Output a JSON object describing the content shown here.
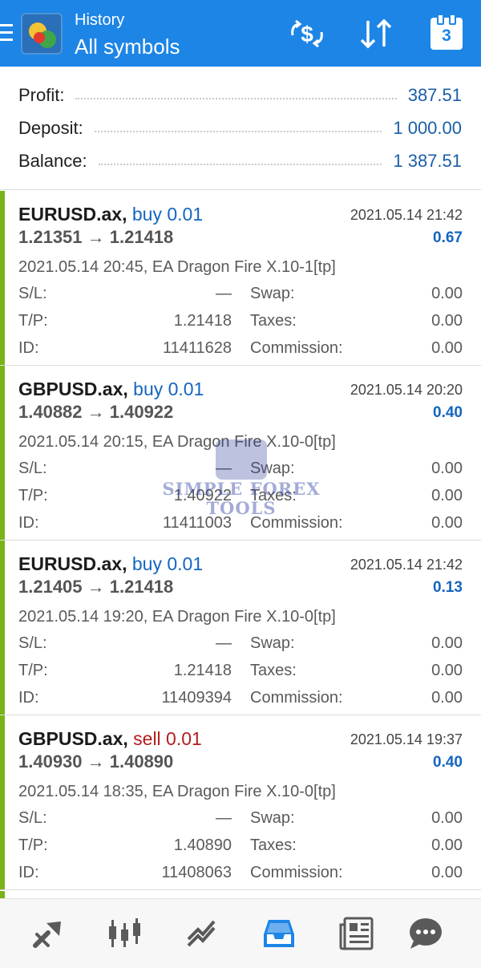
{
  "header": {
    "subtitle": "History",
    "title": "All symbols",
    "calendar_day": "3",
    "colors": {
      "bar": "#1d85e6"
    }
  },
  "summary": {
    "profit_label": "Profit:",
    "profit_value": "387.51",
    "deposit_label": "Deposit:",
    "deposit_value": "1 000.00",
    "balance_label": "Balance:",
    "balance_value": "1 387.51"
  },
  "deals": [
    {
      "symbol": "EURUSD.ax,",
      "type": "buy 0.01",
      "close_time": "2021.05.14 21:42",
      "prices": "1.21351 → 1.21418",
      "profit": "0.67",
      "comment": "2021.05.14 20:45, EA Dragon Fire X.10-1[tp]",
      "sl_label": "S/L:",
      "sl": "—",
      "tp_label": "T/P:",
      "tp": "1.21418",
      "id_label": "ID:",
      "id": "11411628",
      "swap_label": "Swap:",
      "swap": "0.00",
      "taxes_label": "Taxes:",
      "taxes": "0.00",
      "commission_label": "Commission:",
      "commission": "0.00"
    },
    {
      "symbol": "GBPUSD.ax,",
      "type": "buy 0.01",
      "close_time": "2021.05.14 20:20",
      "prices": "1.40882 → 1.40922",
      "profit": "0.40",
      "comment": "2021.05.14 20:15, EA Dragon Fire X.10-0[tp]",
      "sl_label": "S/L:",
      "sl": "—",
      "tp_label": "T/P:",
      "tp": "1.40922",
      "id_label": "ID:",
      "id": "11411003",
      "swap_label": "Swap:",
      "swap": "0.00",
      "taxes_label": "Taxes:",
      "taxes": "0.00",
      "commission_label": "Commission:",
      "commission": "0.00"
    },
    {
      "symbol": "EURUSD.ax,",
      "type": "buy 0.01",
      "close_time": "2021.05.14 21:42",
      "prices": "1.21405 → 1.21418",
      "profit": "0.13",
      "comment": "2021.05.14 19:20, EA Dragon Fire X.10-0[tp]",
      "sl_label": "S/L:",
      "sl": "—",
      "tp_label": "T/P:",
      "tp": "1.21418",
      "id_label": "ID:",
      "id": "11409394",
      "swap_label": "Swap:",
      "swap": "0.00",
      "taxes_label": "Taxes:",
      "taxes": "0.00",
      "commission_label": "Commission:",
      "commission": "0.00"
    },
    {
      "symbol": "GBPUSD.ax,",
      "type": "sell 0.01",
      "close_time": "2021.05.14 19:37",
      "prices": "1.40930 → 1.40890",
      "profit": "0.40",
      "comment": "2021.05.14 18:35, EA Dragon Fire X.10-0[tp]",
      "sl_label": "S/L:",
      "sl": "—",
      "tp_label": "T/P:",
      "tp": "1.40890",
      "id_label": "ID:",
      "id": "11408063",
      "swap_label": "Swap:",
      "swap": "0.00",
      "taxes_label": "Taxes:",
      "taxes": "0.00",
      "commission_label": "Commission:",
      "commission": "0.00"
    }
  ],
  "watermark": {
    "line1": "SIMPLE FOREX",
    "line2": "TOOLS"
  },
  "nav": [
    {
      "icon": "quotes-icon"
    },
    {
      "icon": "chart-icon"
    },
    {
      "icon": "trade-icon"
    },
    {
      "icon": "history-icon",
      "active": true
    },
    {
      "icon": "news-icon"
    },
    {
      "icon": "chat-icon"
    }
  ],
  "colors": {
    "accent": "#1d85e6",
    "value_blue": "#1a5fa8",
    "buy": "#1565c0",
    "sell": "#b41c1c",
    "deal_bar": "#7ab317",
    "nav_icon": "#5a5a5a",
    "nav_active": "#1d85e6"
  }
}
